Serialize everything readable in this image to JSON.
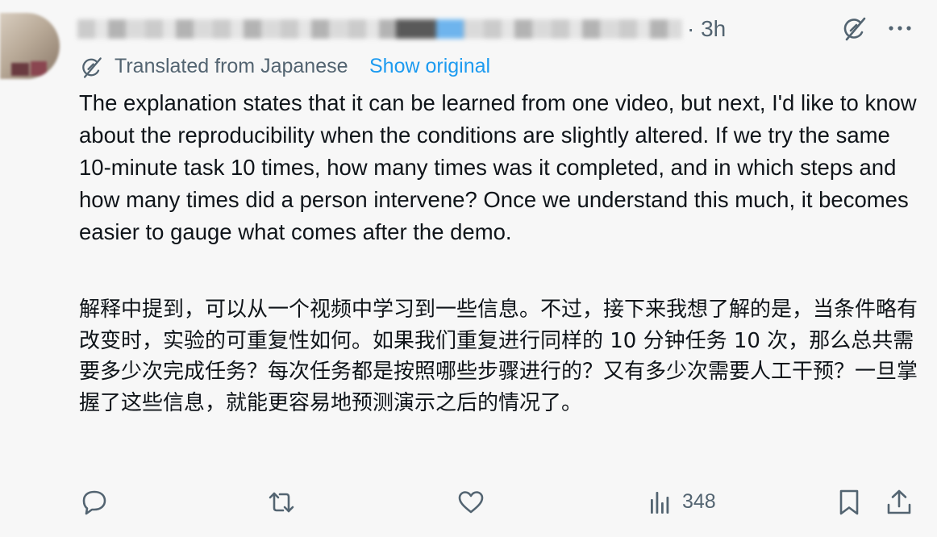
{
  "post": {
    "timestamp": "3h",
    "translated_from": "Translated from Japanese",
    "show_original": "Show original",
    "text_en": "The explanation states that it can be learned from one video, but next, I'd like to know about the reproducibility when the conditions are slightly altered. If we try the same 10-minute task 10 times, how many times was it completed, and in which steps and how many times did a person intervene? Once we understand this much, it becomes easier to gauge what comes after the demo.",
    "text_zh": "解释中提到，可以从一个视频中学习到一些信息。不过，接下来我想了解的是，当条件略有改变时，实验的可重复性如何。如果我们重复进行同样的 10 分钟任务 10 次，那么总共需要多少次完成任务？每次任务都是按照哪些步骤进行的？又有多少次需要人工干预？一旦掌握了这些信息，就能更容易地预测演示之后的情况了。"
  },
  "actions": {
    "views": "348"
  },
  "icons": {
    "grok": "grok-icon",
    "more": "more-icon",
    "translate": "translate-icon",
    "reply": "reply-icon",
    "repost": "repost-icon",
    "like": "like-icon",
    "views": "views-icon",
    "bookmark": "bookmark-icon",
    "share": "share-icon"
  },
  "colors": {
    "background": "#f7f7f7",
    "text": "#0f1419",
    "muted": "#536471",
    "link": "#1d9bf0"
  }
}
